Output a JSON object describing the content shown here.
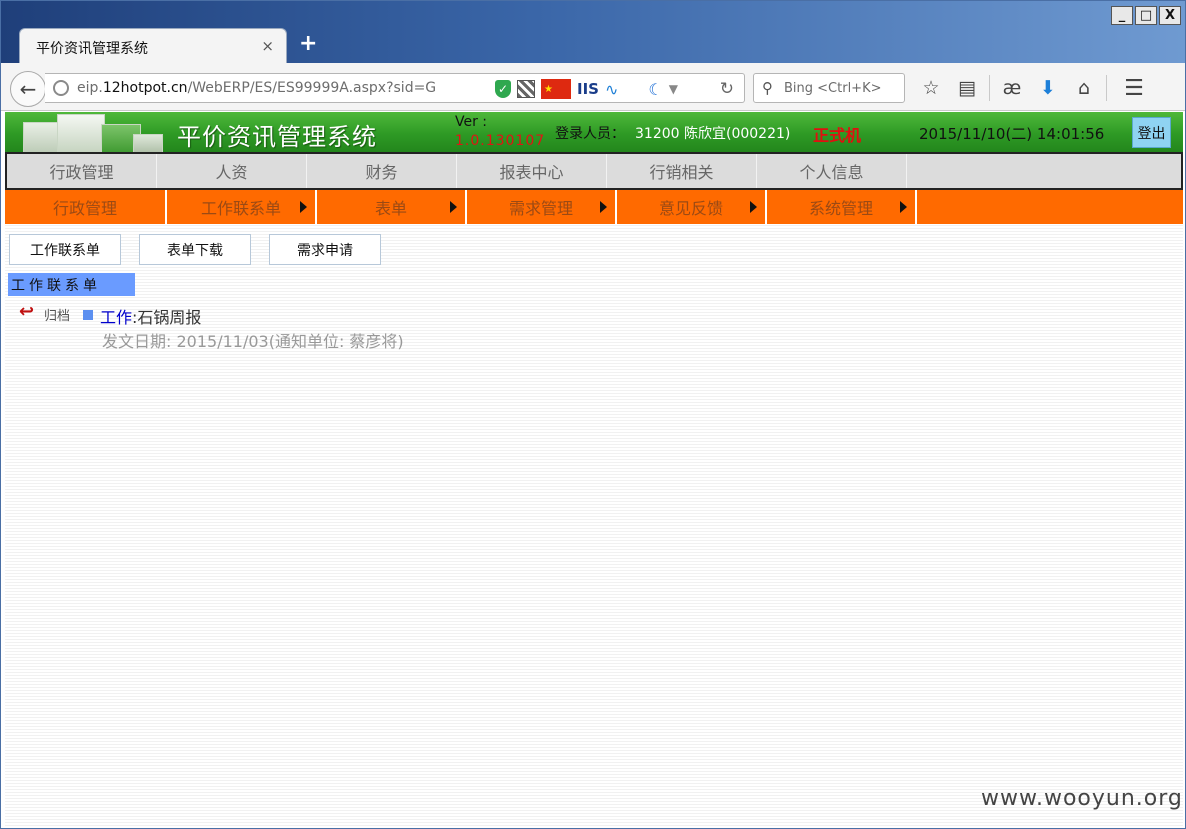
{
  "browser": {
    "tab_title": "平价资讯管理系统",
    "tab_close": "×",
    "new_tab": "+",
    "url_prefix": "eip.",
    "url_domain": "12hotpot.cn",
    "url_path": "/WebERP/ES/ES99999A.aspx?sid=G",
    "search_placeholder": "Bing <Ctrl+K>",
    "ext_iis": "IIS",
    "window_buttons": [
      "_",
      "□",
      "X"
    ]
  },
  "header": {
    "system_title": "平价资讯管理系统",
    "ver_label": "Ver :",
    "ver_number": "1.0.130107",
    "login_label": "登录人员：",
    "login_user": "31200 陈欣宜(000221)",
    "environment": "正式机",
    "datetime": "2015/11/10(二) 14:01:56",
    "logout_label": "登出",
    "colors": {
      "header_green": "#2e9a25",
      "env_red": "#e01010",
      "menu_orange": "#ff6a00"
    }
  },
  "main_menu": [
    {
      "label": "行政管理"
    },
    {
      "label": "人资"
    },
    {
      "label": "财务"
    },
    {
      "label": "报表中心"
    },
    {
      "label": "行销相关"
    },
    {
      "label": "个人信息"
    }
  ],
  "sub_menu": [
    {
      "label": "行政管理",
      "has_arrow": false
    },
    {
      "label": "工作联系单",
      "has_arrow": true
    },
    {
      "label": "表单",
      "has_arrow": true
    },
    {
      "label": "需求管理",
      "has_arrow": true
    },
    {
      "label": "意见反馈",
      "has_arrow": true
    },
    {
      "label": "系统管理",
      "has_arrow": true
    }
  ],
  "action_buttons": [
    {
      "label": "工作联系单"
    },
    {
      "label": "表单下载"
    },
    {
      "label": "需求申请"
    }
  ],
  "section": {
    "title": "工作联系单",
    "entries": [
      {
        "archive_label": "归档",
        "category_link": "工作",
        "separator": ":",
        "subject": "石锅周报",
        "meta": "发文日期: 2015/11/03(通知单位: 蔡彦将)"
      }
    ]
  },
  "watermark": "www.wooyun.org"
}
